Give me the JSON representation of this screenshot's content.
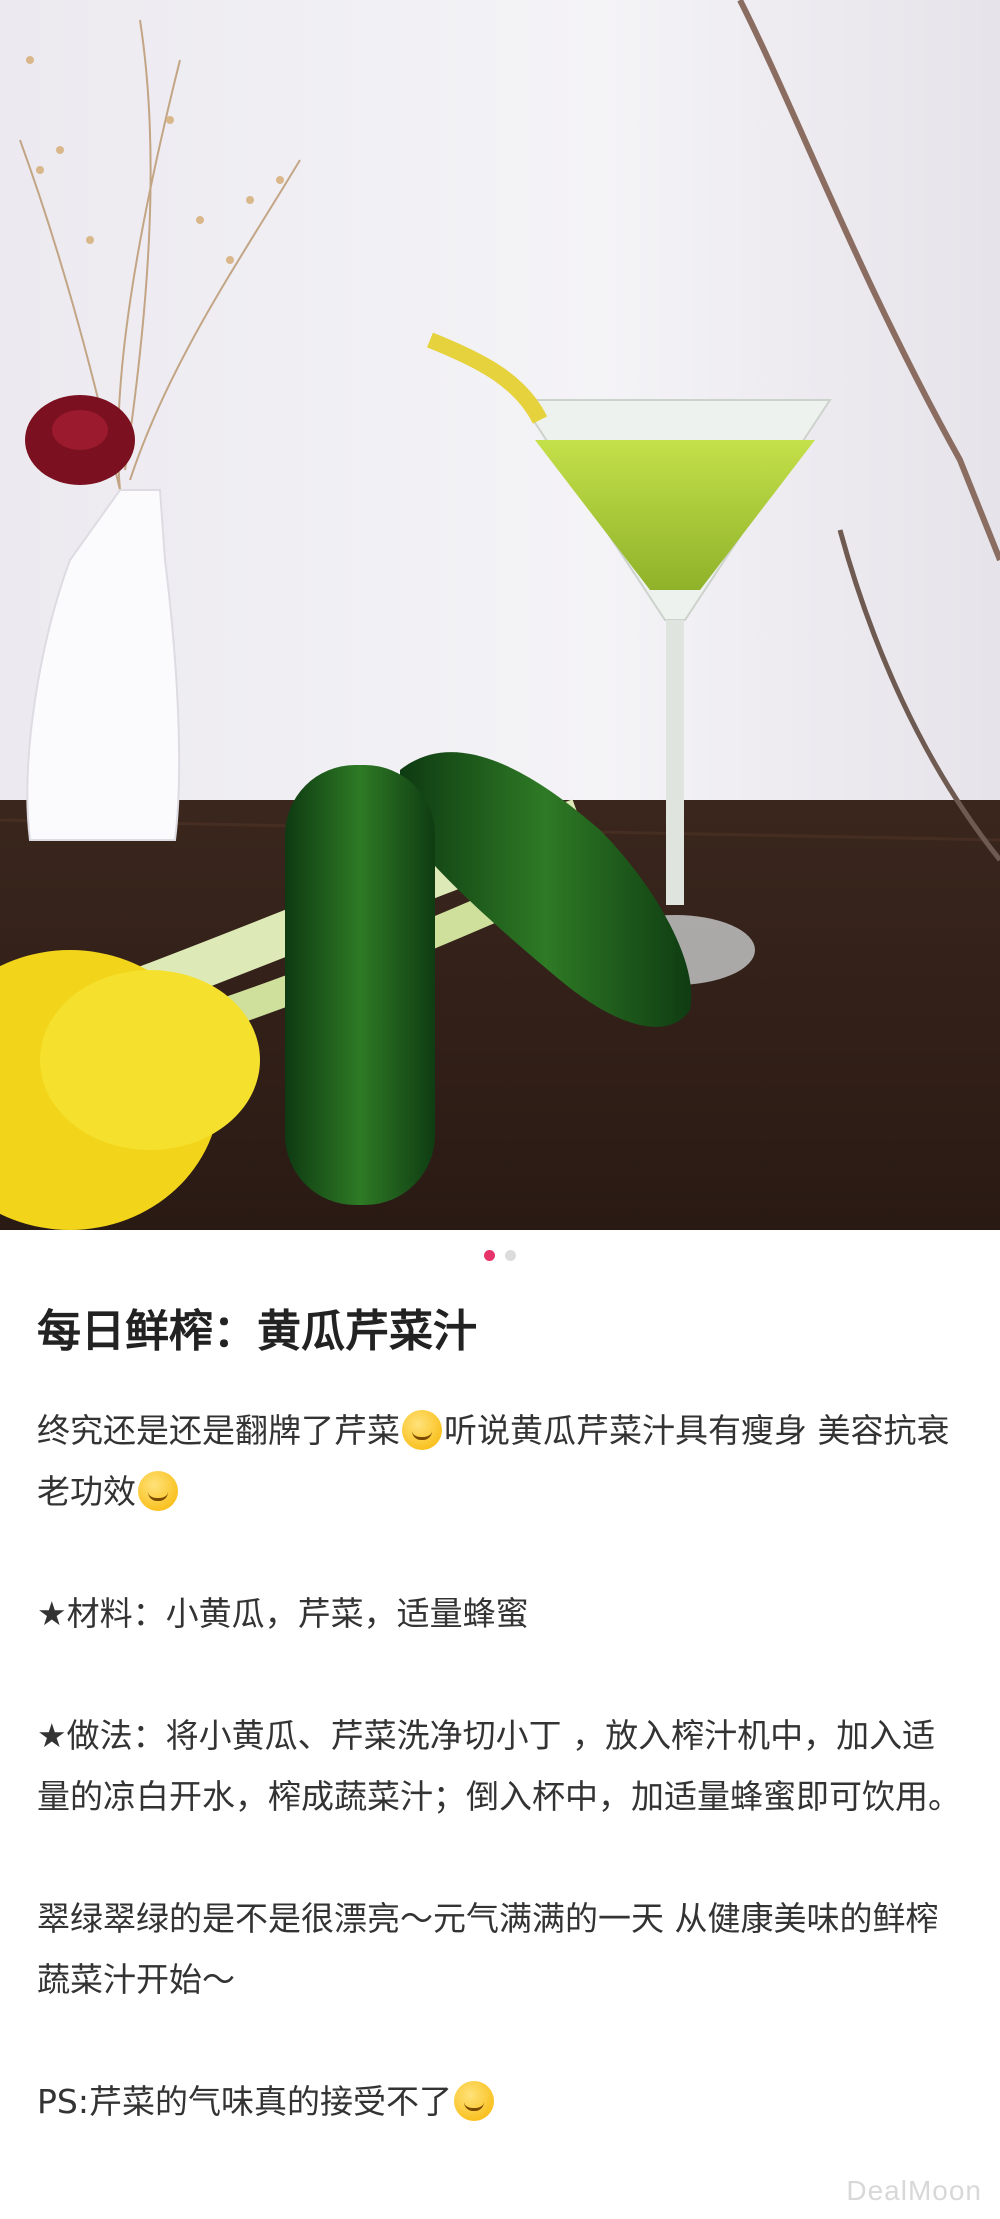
{
  "gallery": {
    "total_images": 2,
    "active_index": 0
  },
  "post": {
    "title": "每日鲜榨：黄瓜芹菜汁",
    "paragraphs": [
      "终究还是还是翻牌了芹菜",
      "听说黄瓜芹菜汁具有瘦身 美容抗衰老功效",
      "★材料：小黄瓜，芹菜，适量蜂蜜",
      "★做法：将小黄瓜、芹菜洗净切小丁 ，放入榨汁机中，加入适量的凉白开水，榨成蔬菜汁；倒入杯中，加适量蜂蜜即可饮用。",
      "翠绿翠绿的是不是很漂亮～元气满满的一天 从健康美味的鲜榨蔬菜汁开始～",
      "PS:芹菜的气味真的接受不了"
    ]
  },
  "watermark": "DealMoon",
  "icons": {
    "emoji_1": "upside-down-face-emoji-icon",
    "emoji_2": "smirk-face-emoji-icon",
    "emoji_3": "zany-face-emoji-icon"
  }
}
